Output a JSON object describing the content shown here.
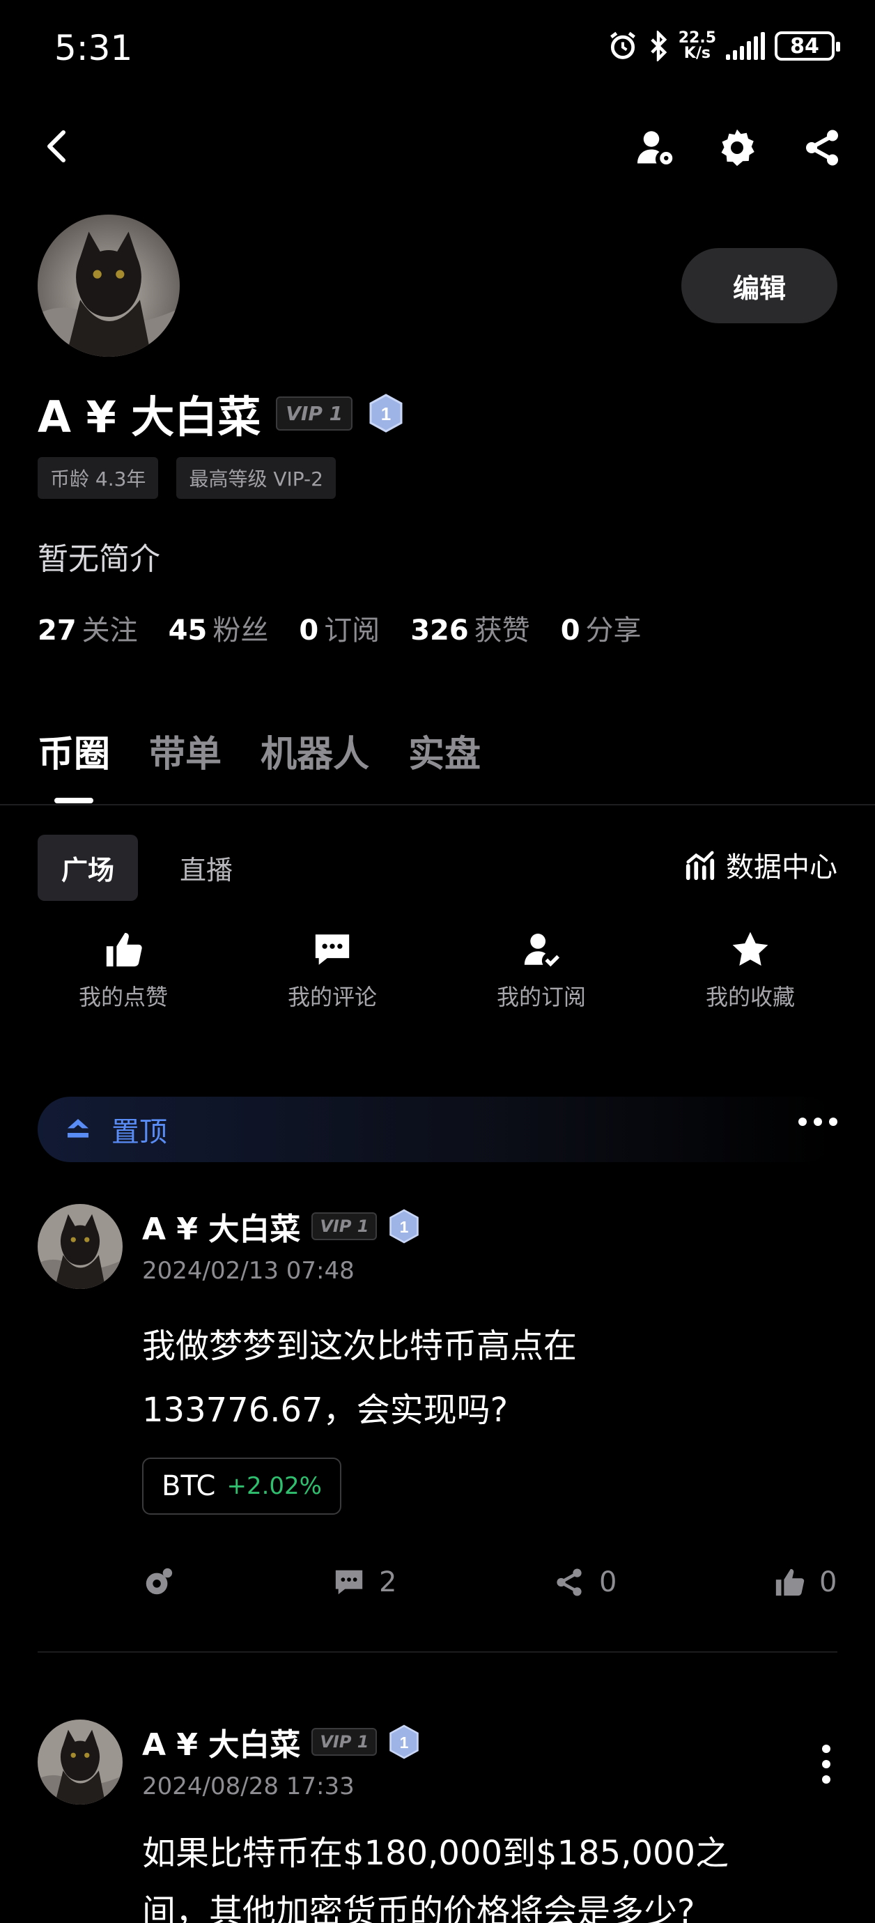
{
  "status_bar": {
    "time": "5:31",
    "net_speed": "22.5",
    "net_unit": "K/s",
    "battery": "84"
  },
  "profile": {
    "name": "A ¥ 大白菜",
    "vip": "VIP 1",
    "level": "1",
    "edit_label": "编辑",
    "tags": [
      "币龄 4.3年",
      "最高等级 VIP-2"
    ],
    "bio": "暂无简介",
    "stats": [
      {
        "num": "27",
        "label": "关注"
      },
      {
        "num": "45",
        "label": "粉丝"
      },
      {
        "num": "0",
        "label": "订阅"
      },
      {
        "num": "326",
        "label": "获赞"
      },
      {
        "num": "0",
        "label": "分享"
      }
    ]
  },
  "tabs": [
    "币圈",
    "带单",
    "机器人",
    "实盘"
  ],
  "subtabs": [
    "广场",
    "直播"
  ],
  "data_center": "数据中心",
  "quick_actions": [
    {
      "label": "我的点赞",
      "icon": "thumbs-up-icon"
    },
    {
      "label": "我的评论",
      "icon": "comment-icon"
    },
    {
      "label": "我的订阅",
      "icon": "user-check-icon"
    },
    {
      "label": "我的收藏",
      "icon": "star-icon"
    }
  ],
  "pinned_label": "置顶",
  "posts": [
    {
      "name": "A ¥ 大白菜",
      "vip": "VIP 1",
      "level": "1",
      "date": "2024/02/13 07:48",
      "text_line1": "我做梦梦到这次比特币高点在",
      "text_line2": "133776.67，会实现吗?",
      "coin_symbol": "BTC",
      "coin_change": "+2.02%",
      "comments": "2",
      "shares": "0",
      "likes": "0"
    },
    {
      "name": "A ¥ 大白菜",
      "vip": "VIP 1",
      "level": "1",
      "date": "2024/08/28 17:33",
      "text_line1": "如果比特币在$180,000到$185,000之",
      "text_line2": "间，其他加密货币的价格将会是多少?"
    }
  ],
  "colors": {
    "background": "#000000",
    "accent_blue": "#5a8cf5",
    "positive_green": "#2fbf6f",
    "muted_text": "#8d8d92"
  }
}
